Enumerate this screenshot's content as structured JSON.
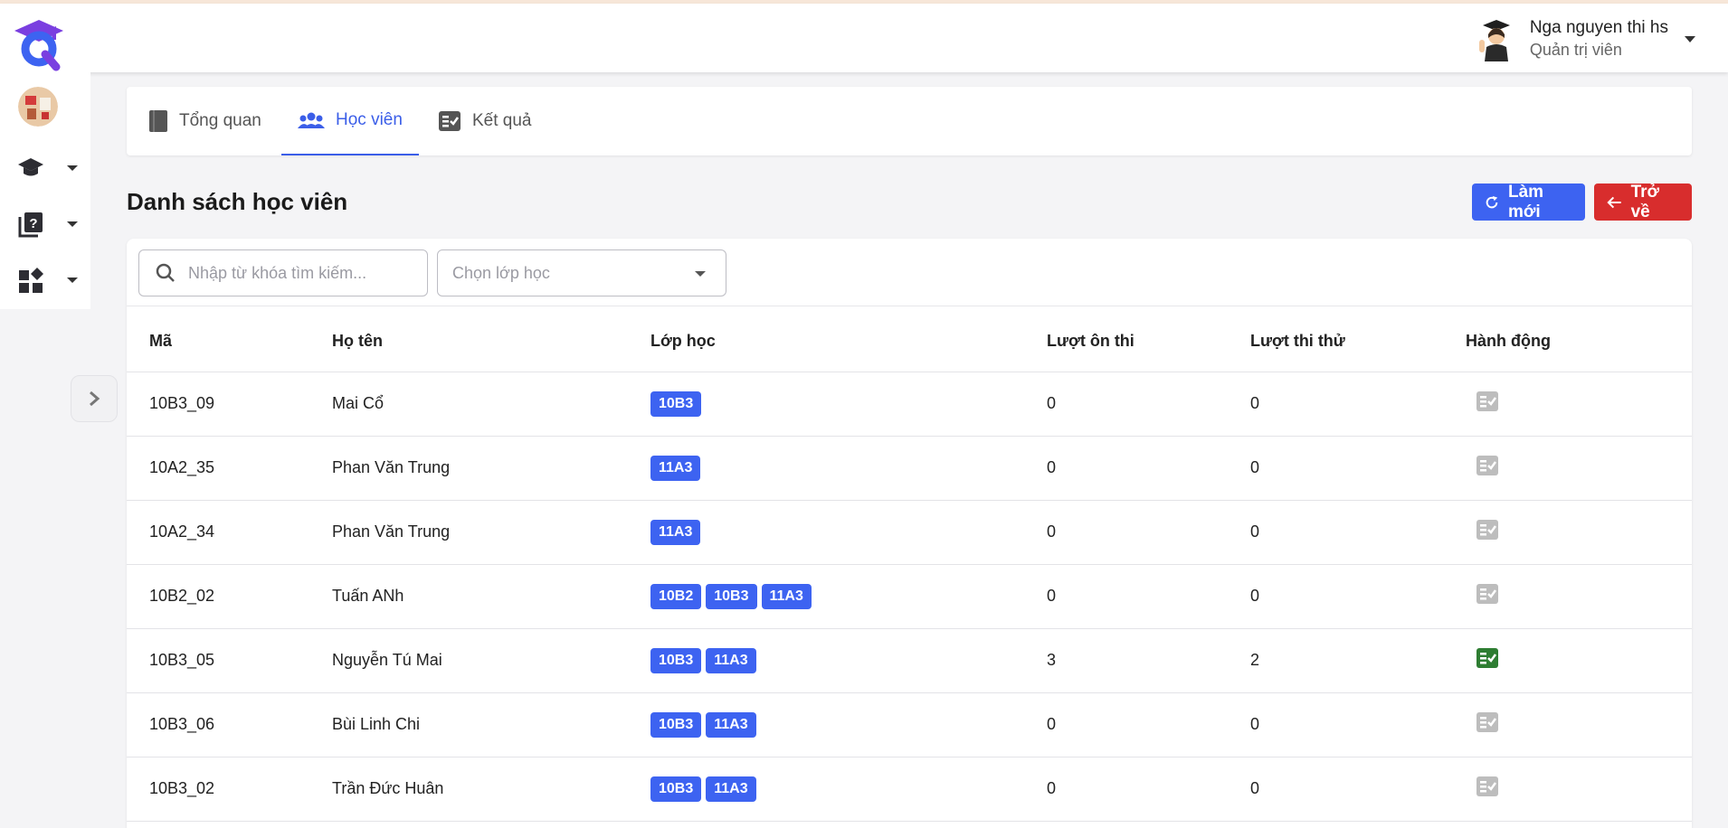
{
  "header": {
    "user_name": "Nga nguyen thi hs",
    "user_role": "Quản trị viên"
  },
  "colors": {
    "primary": "#3d63f1",
    "danger": "#d82d2d",
    "active_action": "#2e7d32",
    "inactive_action": "#bdbdbd"
  },
  "tabs": [
    {
      "label": "Tổng quan",
      "icon": "book-icon",
      "active": false
    },
    {
      "label": "Học viên",
      "icon": "users-icon",
      "active": true
    },
    {
      "label": "Kết quả",
      "icon": "checklist-icon",
      "active": false
    }
  ],
  "page": {
    "title": "Danh sách học viên",
    "refresh_label": "Làm mới",
    "back_label": "Trở về"
  },
  "filters": {
    "search_placeholder": "Nhập từ khóa tìm kiếm...",
    "class_placeholder": "Chọn lớp học"
  },
  "table": {
    "columns": [
      "Mã",
      "Họ tên",
      "Lớp học",
      "Lượt ôn thi",
      "Lượt thi thử",
      "Hành động"
    ],
    "rows": [
      {
        "code": "10B3_09",
        "name": "Mai Cổ",
        "classes": [
          "10B3"
        ],
        "practice": "0",
        "mock": "0",
        "action_active": false
      },
      {
        "code": "10A2_35",
        "name": "Phan Văn Trung",
        "classes": [
          "11A3"
        ],
        "practice": "0",
        "mock": "0",
        "action_active": false
      },
      {
        "code": "10A2_34",
        "name": "Phan Văn Trung",
        "classes": [
          "11A3"
        ],
        "practice": "0",
        "mock": "0",
        "action_active": false
      },
      {
        "code": "10B2_02",
        "name": "Tuấn ANh",
        "classes": [
          "10B2",
          "10B3",
          "11A3"
        ],
        "practice": "0",
        "mock": "0",
        "action_active": false
      },
      {
        "code": "10B3_05",
        "name": "Nguyễn Tú Mai",
        "classes": [
          "10B3",
          "11A3"
        ],
        "practice": "3",
        "mock": "2",
        "action_active": true
      },
      {
        "code": "10B3_06",
        "name": "Bùi Linh Chi",
        "classes": [
          "10B3",
          "11A3"
        ],
        "practice": "0",
        "mock": "0",
        "action_active": false
      },
      {
        "code": "10B3_02",
        "name": "Trần Đức Huân",
        "classes": [
          "10B3",
          "11A3"
        ],
        "practice": "0",
        "mock": "0",
        "action_active": false
      }
    ]
  }
}
